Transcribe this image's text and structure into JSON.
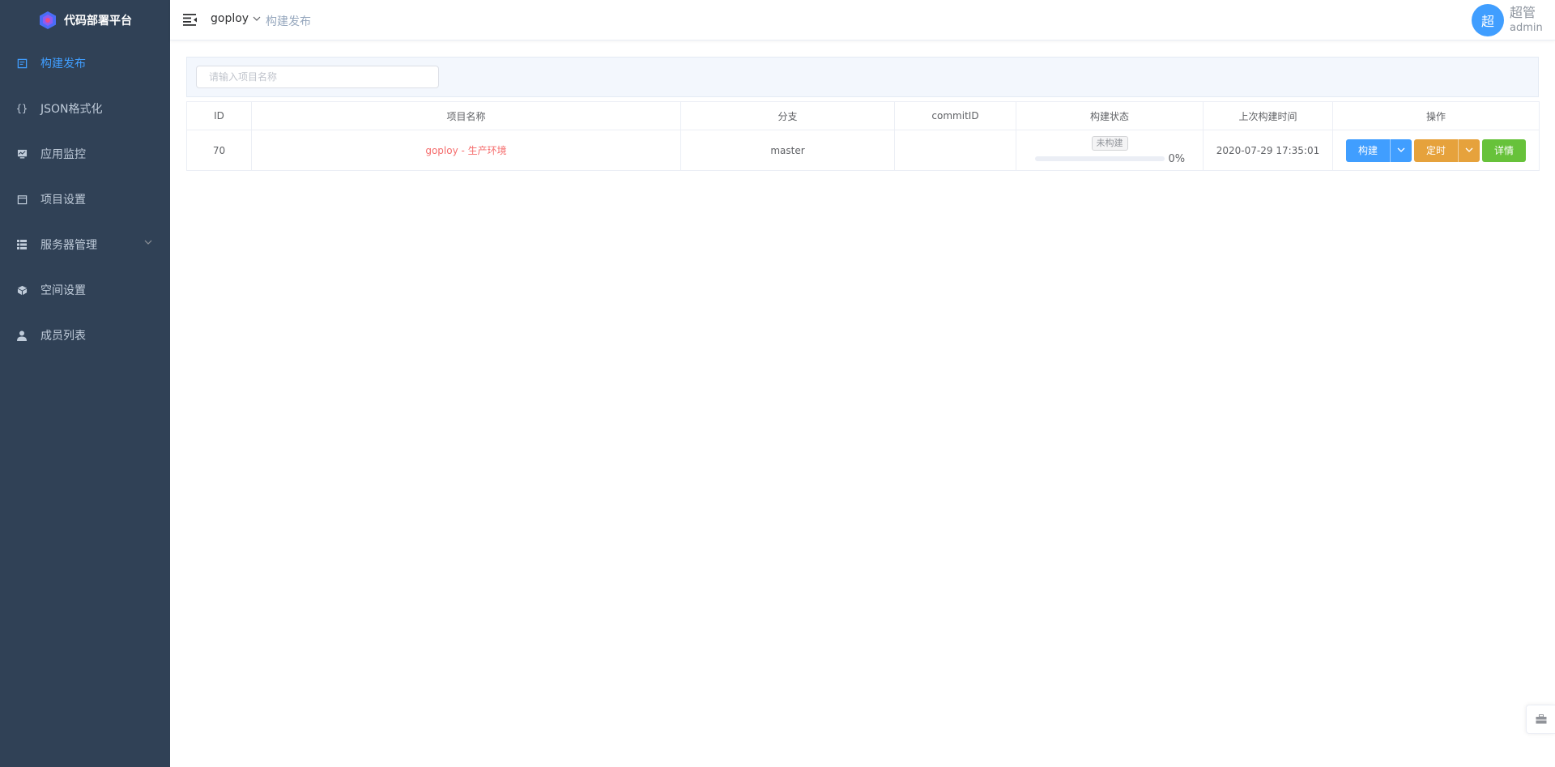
{
  "app": {
    "title": "代码部署平台"
  },
  "sidebar": {
    "items": [
      {
        "label": "构建发布",
        "icon": "deploy-icon",
        "active": true
      },
      {
        "label": "JSON格式化",
        "icon": "braces-icon"
      },
      {
        "label": "应用监控",
        "icon": "monitor-icon"
      },
      {
        "label": "项目设置",
        "icon": "project-icon"
      },
      {
        "label": "服务器管理",
        "icon": "server-icon",
        "expandable": true
      },
      {
        "label": "空间设置",
        "icon": "cube-icon"
      },
      {
        "label": "成员列表",
        "icon": "user-icon"
      }
    ]
  },
  "header": {
    "namespace": "goploy",
    "breadcrumb": "构建发布",
    "user": {
      "avatar_text": "超",
      "name": "超管",
      "role": "admin"
    }
  },
  "search": {
    "placeholder": "请输入项目名称",
    "value": ""
  },
  "table": {
    "columns": [
      "ID",
      "项目名称",
      "分支",
      "commitID",
      "构建状态",
      "上次构建时间",
      "操作"
    ],
    "rows": [
      {
        "id": "70",
        "name": "goploy - 生产环境",
        "branch": "master",
        "commit_id": "",
        "status": "未构建",
        "progress": 0,
        "progress_text": "0%",
        "last_build_time": "2020-07-29 17:35:01"
      }
    ],
    "actions": {
      "build": "构建",
      "schedule": "定时",
      "detail": "详情"
    }
  },
  "colors": {
    "sidebar_bg": "#304156",
    "primary": "#409eff",
    "warning": "#e6a23c",
    "success": "#67c23a",
    "danger": "#f56c6c"
  }
}
